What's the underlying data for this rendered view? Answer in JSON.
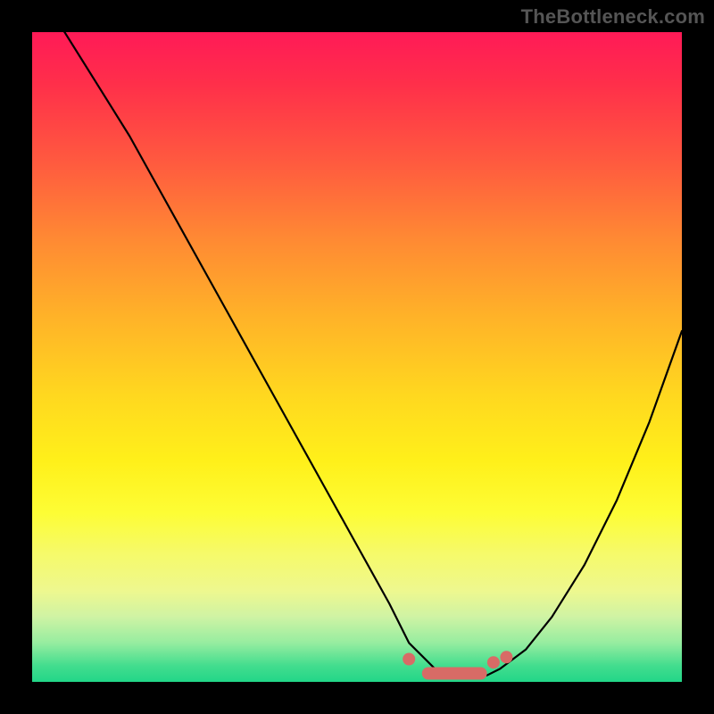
{
  "watermark": {
    "text": "TheBottleneck.com"
  },
  "colors": {
    "page_bg": "#000000",
    "curve_stroke": "#000000",
    "marker_fill": "#d86b66",
    "marker_pill_fill": "#d86b66"
  },
  "chart_data": {
    "type": "line",
    "title": "",
    "xlabel": "",
    "ylabel": "",
    "xlim": [
      0,
      100
    ],
    "ylim": [
      0,
      100
    ],
    "grid": false,
    "legend": null,
    "series": [
      {
        "name": "bottleneck-curve",
        "x": [
          0,
          5,
          10,
          15,
          20,
          25,
          30,
          35,
          40,
          45,
          50,
          55,
          58,
          62,
          66,
          70,
          72,
          76,
          80,
          85,
          90,
          95,
          100
        ],
        "y": [
          106,
          100,
          92,
          84,
          75,
          66,
          57,
          48,
          39,
          30,
          21,
          12,
          6,
          2,
          1,
          1,
          2,
          5,
          10,
          18,
          28,
          40,
          54
        ]
      }
    ],
    "markers": {
      "points": [
        {
          "x": 58,
          "y": 3.5
        },
        {
          "x": 71,
          "y": 3.0
        },
        {
          "x": 73,
          "y": 3.8
        }
      ],
      "pill": {
        "x0": 60,
        "x1": 70,
        "y": 1.3
      }
    },
    "annotations": []
  }
}
